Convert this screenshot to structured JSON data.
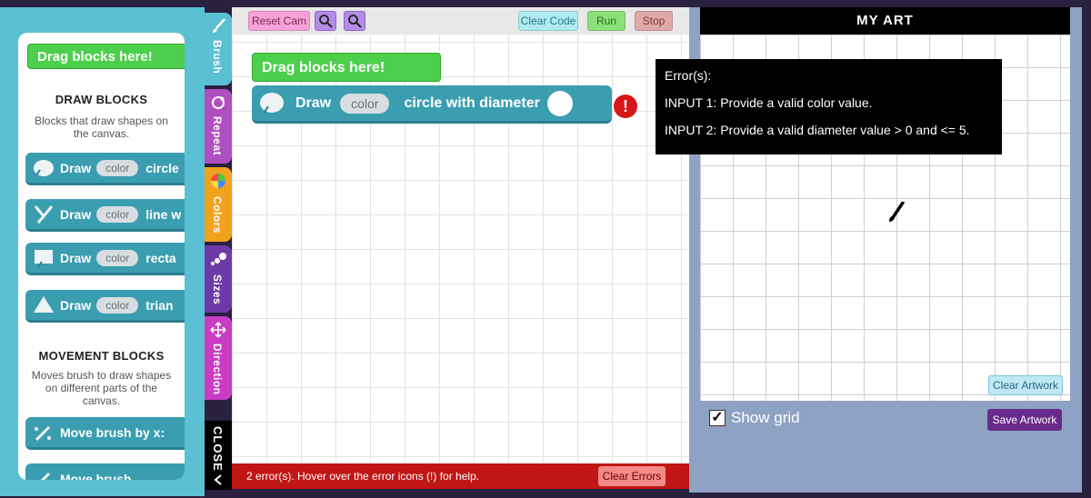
{
  "palette": {
    "drag_here": "Drag blocks here!",
    "draw_title": "DRAW BLOCKS",
    "draw_desc": "Blocks that draw shapes on the canvas.",
    "blocks": [
      {
        "label": "Draw",
        "param": "color",
        "tail": "circle"
      },
      {
        "label": "Draw",
        "param": "color",
        "tail": "line w"
      },
      {
        "label": "Draw",
        "param": "color",
        "tail": "recta"
      },
      {
        "label": "Draw",
        "param": "color",
        "tail": "trian"
      }
    ],
    "movement_title": "MOVEMENT BLOCKS",
    "movement_desc": "Moves brush to draw shapes on different parts of the canvas.",
    "move_block": "Move brush by x:",
    "move_block_2": "Move brush"
  },
  "tabs": [
    {
      "label": "Brush",
      "color": "#5bc0d4"
    },
    {
      "label": "Repeat",
      "color": "#b04fc0"
    },
    {
      "label": "Colors",
      "color": "#f2a21e"
    },
    {
      "label": "Sizes",
      "color": "#6e3aa8"
    },
    {
      "label": "Direction",
      "color": "#c93cc4"
    },
    {
      "label": "CLOSE",
      "color": "#000000"
    }
  ],
  "toolbar": {
    "reset_cam": "Reset Cam",
    "clear_code": "Clear Code",
    "run": "Run",
    "stop": "Stop"
  },
  "workspace": {
    "hat": "Drag blocks here!",
    "block_label": "Draw",
    "block_param": "color",
    "block_text": "circle with diameter",
    "error_icon": "!"
  },
  "error_bar": {
    "message": "2 error(s). Hover over the error icons (!) for help.",
    "clear_errors": "Clear Errors"
  },
  "art": {
    "title": "MY ART",
    "clear_artwork": "Clear Artwork",
    "show_grid": "Show grid",
    "show_grid_checked": true,
    "save_artwork": "Save Artwork"
  },
  "errors_tooltip": {
    "heading": "Error(s):",
    "lines": [
      "INPUT 1: Provide a valid color value.",
      "INPUT 2: Provide a valid diameter value > 0 and <= 5."
    ]
  }
}
